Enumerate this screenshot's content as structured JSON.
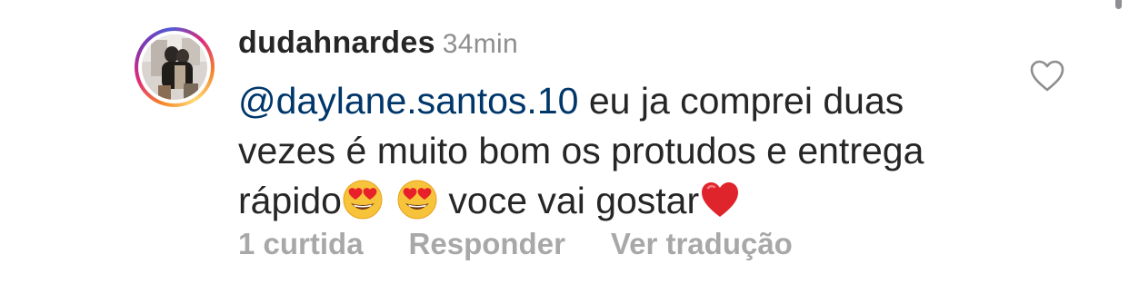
{
  "comment": {
    "username": "dudahnardes",
    "time": "34min",
    "mention": "@daylane.santos.10",
    "text_part1": "eu ja comprei duas vezes é muito bom os protudos e entrega rápido",
    "text_part2": "voce vai gostar",
    "emojis": [
      "heart-eyes-emoji",
      "heart-eyes-emoji",
      "red-heart-emoji"
    ]
  },
  "actions": {
    "likes": "1 curtida",
    "reply": "Responder",
    "translate": "Ver tradução"
  },
  "colors": {
    "text": "#262626",
    "mention": "#00376b",
    "muted": "#8e8e8e",
    "action": "#a8a8a8"
  },
  "icons": {
    "like": "heart-outline-icon"
  }
}
